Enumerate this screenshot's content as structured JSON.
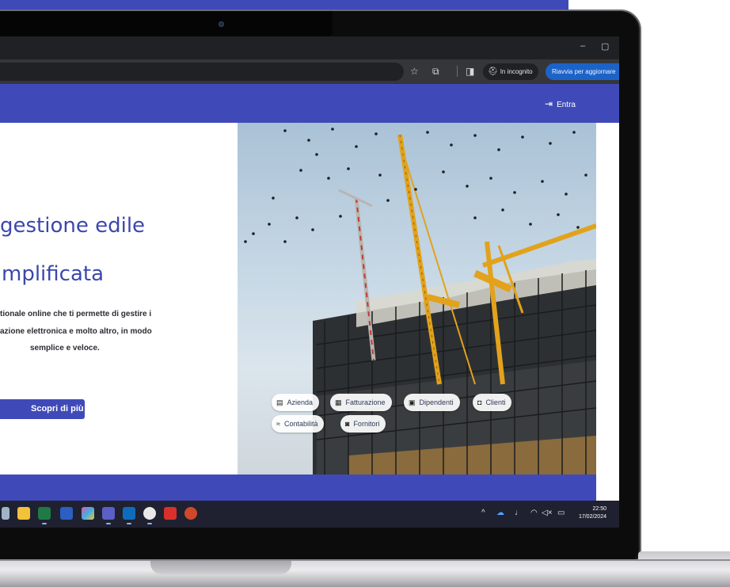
{
  "colors": {
    "brand": "#3f4ab8",
    "relaunch_button": "#1d63c7",
    "taskbar": "#1f2130"
  },
  "browser": {
    "window_controls": {
      "minimize": "–",
      "maximize": "▢"
    },
    "toolbar_icons": [
      "star-icon",
      "extensions-icon",
      "side-panel-icon"
    ],
    "incognito_label": "In incognito",
    "relaunch_label": "Riavvia per aggiornare"
  },
  "site": {
    "header": {
      "login_label": "Entra",
      "login_icon": "login-arrow-icon"
    },
    "hero": {
      "title_line1": "gestione edile",
      "title_line2": "mplificata",
      "description": [
        "tionale online che ti permette di gestire i",
        "azione elettronica e molto altro, in modo",
        "semplice e veloce."
      ],
      "cta_label": "Scopri di più"
    },
    "feature_chips": [
      {
        "label": "Azienda",
        "icon": "building-icon",
        "glyph": "▤"
      },
      {
        "label": "Fatturazione",
        "icon": "invoice-icon",
        "glyph": "▦"
      },
      {
        "label": "Dipendenti",
        "icon": "badge-icon",
        "glyph": "▣"
      },
      {
        "label": "Clienti",
        "icon": "people-icon",
        "glyph": "◘"
      },
      {
        "label": "Contabilità",
        "icon": "trend-icon",
        "glyph": "≈"
      },
      {
        "label": "Fornitori",
        "icon": "truck-icon",
        "glyph": "◙"
      }
    ]
  },
  "taskbar": {
    "apps": [
      "file-explorer-icon",
      "excel-icon",
      "word-icon",
      "copilot-icon",
      "teams-icon",
      "outlook-icon",
      "chrome-icon",
      "acrobat-icon",
      "powerpoint-icon"
    ],
    "tray_icons": [
      "chevron-up-icon",
      "onedrive-icon",
      "microphone-icon",
      "wifi-icon",
      "speaker-muted-icon",
      "battery-icon"
    ],
    "clock_time": "22:50",
    "clock_date": "17/02/2024"
  }
}
